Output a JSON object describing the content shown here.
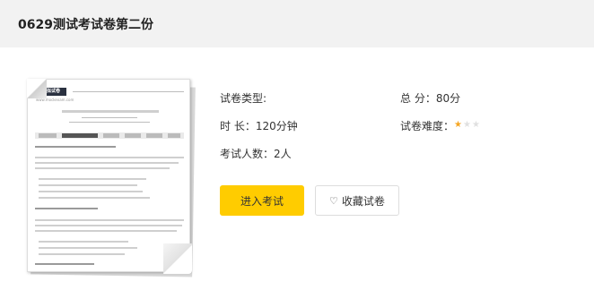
{
  "page": {
    "title": "0629测试考试卷第二份"
  },
  "paper_thumbnail": {
    "logo_text": "模拟试卷",
    "logo_sub": "www.mockexam.com"
  },
  "info": {
    "type_label": "试卷类型:",
    "type_value": "",
    "total_score": "总 分：80分",
    "duration": "时 长：120分钟",
    "difficulty_label": "试卷难度：",
    "difficulty_rating": 1,
    "difficulty_max": 3,
    "participants": "考试人数：2人"
  },
  "buttons": {
    "enter_label": "进入考试",
    "favorite_label": "收藏试卷"
  },
  "colors": {
    "accent": "#ffcc00",
    "star_on": "#f5a623",
    "star_off": "#e0e0e0",
    "topbar_bg": "#f2f2f2"
  }
}
